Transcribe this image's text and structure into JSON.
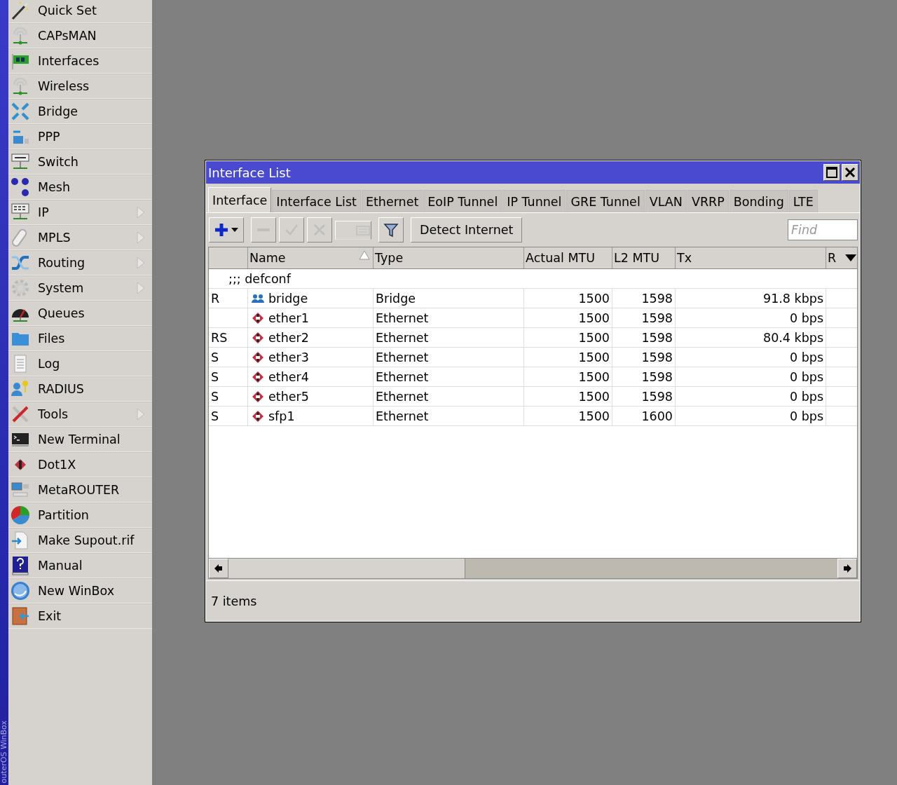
{
  "side_strip": {
    "text": "outerOS WinBox"
  },
  "sidebar": {
    "items": [
      {
        "label": "Quick Set",
        "submenu": false
      },
      {
        "label": "CAPsMAN",
        "submenu": false
      },
      {
        "label": "Interfaces",
        "submenu": false
      },
      {
        "label": "Wireless",
        "submenu": false
      },
      {
        "label": "Bridge",
        "submenu": false
      },
      {
        "label": "PPP",
        "submenu": false
      },
      {
        "label": "Switch",
        "submenu": false
      },
      {
        "label": "Mesh",
        "submenu": false
      },
      {
        "label": "IP",
        "submenu": true
      },
      {
        "label": "MPLS",
        "submenu": true
      },
      {
        "label": "Routing",
        "submenu": true
      },
      {
        "label": "System",
        "submenu": true
      },
      {
        "label": "Queues",
        "submenu": false
      },
      {
        "label": "Files",
        "submenu": false
      },
      {
        "label": "Log",
        "submenu": false
      },
      {
        "label": "RADIUS",
        "submenu": false
      },
      {
        "label": "Tools",
        "submenu": true
      },
      {
        "label": "New Terminal",
        "submenu": false
      },
      {
        "label": "Dot1X",
        "submenu": false
      },
      {
        "label": "MetaROUTER",
        "submenu": false
      },
      {
        "label": "Partition",
        "submenu": false
      },
      {
        "label": "Make Supout.rif",
        "submenu": false
      },
      {
        "label": "Manual",
        "submenu": false
      },
      {
        "label": "New WinBox",
        "submenu": false
      },
      {
        "label": "Exit",
        "submenu": false
      }
    ]
  },
  "window": {
    "title": "Interface List",
    "tabs": [
      {
        "label": "Interface",
        "selected": true
      },
      {
        "label": "Interface List",
        "selected": false
      },
      {
        "label": "Ethernet",
        "selected": false
      },
      {
        "label": "EoIP Tunnel",
        "selected": false
      },
      {
        "label": "IP Tunnel",
        "selected": false
      },
      {
        "label": "GRE Tunnel",
        "selected": false
      },
      {
        "label": "VLAN",
        "selected": false
      },
      {
        "label": "VRRP",
        "selected": false
      },
      {
        "label": "Bonding",
        "selected": false
      },
      {
        "label": "LTE",
        "selected": false
      }
    ],
    "toolbar": {
      "buttons": [
        {
          "kind": "add",
          "disabled": false
        },
        {
          "kind": "remove",
          "disabled": true
        },
        {
          "kind": "enable",
          "disabled": true
        },
        {
          "kind": "disable",
          "disabled": true
        },
        {
          "kind": "comment",
          "disabled": true
        },
        {
          "kind": "filter",
          "disabled": false
        }
      ],
      "detect_button": "Detect Internet",
      "find": {
        "placeholder": "Find"
      }
    },
    "table": {
      "columns": [
        "",
        "Name",
        "Type",
        "Actual MTU",
        "L2 MTU",
        "Tx",
        "R"
      ],
      "comment": ";;; defconf",
      "rows": [
        {
          "flags": "R",
          "kind": "bridge",
          "name": "bridge",
          "type": "Bridge",
          "actual_mtu": "1500",
          "l2_mtu": "1598",
          "tx": "91.8 kbps"
        },
        {
          "flags": "",
          "kind": "ethernet",
          "name": "ether1",
          "type": "Ethernet",
          "actual_mtu": "1500",
          "l2_mtu": "1598",
          "tx": "0 bps"
        },
        {
          "flags": "RS",
          "kind": "ethernet",
          "name": "ether2",
          "type": "Ethernet",
          "actual_mtu": "1500",
          "l2_mtu": "1598",
          "tx": "80.4 kbps"
        },
        {
          "flags": "S",
          "kind": "ethernet",
          "name": "ether3",
          "type": "Ethernet",
          "actual_mtu": "1500",
          "l2_mtu": "1598",
          "tx": "0 bps"
        },
        {
          "flags": "S",
          "kind": "ethernet",
          "name": "ether4",
          "type": "Ethernet",
          "actual_mtu": "1500",
          "l2_mtu": "1598",
          "tx": "0 bps"
        },
        {
          "flags": "S",
          "kind": "ethernet",
          "name": "ether5",
          "type": "Ethernet",
          "actual_mtu": "1500",
          "l2_mtu": "1598",
          "tx": "0 bps"
        },
        {
          "flags": "S",
          "kind": "ethernet",
          "name": "sfp1",
          "type": "Ethernet",
          "actual_mtu": "1500",
          "l2_mtu": "1600",
          "tx": "0 bps"
        }
      ]
    },
    "status_bar": {
      "text": "7 items"
    }
  }
}
